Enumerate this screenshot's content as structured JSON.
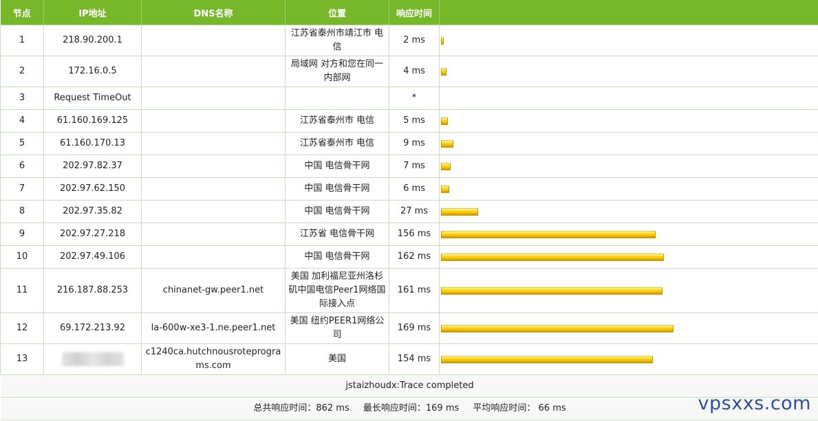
{
  "headers": {
    "node": "节点",
    "ip": "IP地址",
    "dns": "DNS名称",
    "location": "位置",
    "response": "响应时间"
  },
  "hops": [
    {
      "node": "1",
      "ip": "218.90.200.1",
      "dns": "",
      "location": "江苏省泰州市靖江市 电信",
      "time": "2 ms",
      "ms": 2
    },
    {
      "node": "2",
      "ip": "172.16.0.5",
      "dns": "",
      "location": "局域网 对方和您在同一内部网",
      "time": "4 ms",
      "ms": 4
    },
    {
      "node": "3",
      "ip": "Request TimeOut",
      "dns": "",
      "location": "",
      "time": "*",
      "ms": null
    },
    {
      "node": "4",
      "ip": "61.160.169.125",
      "dns": "",
      "location": "江苏省泰州市 电信",
      "time": "5 ms",
      "ms": 5
    },
    {
      "node": "5",
      "ip": "61.160.170.13",
      "dns": "",
      "location": "江苏省泰州市 电信",
      "time": "9 ms",
      "ms": 9
    },
    {
      "node": "6",
      "ip": "202.97.82.37",
      "dns": "",
      "location": "中国 电信骨干网",
      "time": "7 ms",
      "ms": 7
    },
    {
      "node": "7",
      "ip": "202.97.62.150",
      "dns": "",
      "location": "中国 电信骨干网",
      "time": "6 ms",
      "ms": 6
    },
    {
      "node": "8",
      "ip": "202.97.35.82",
      "dns": "",
      "location": "中国 电信骨干网",
      "time": "27 ms",
      "ms": 27
    },
    {
      "node": "9",
      "ip": "202.97.27.218",
      "dns": "",
      "location": "江苏省 电信骨干网",
      "time": "156 ms",
      "ms": 156
    },
    {
      "node": "10",
      "ip": "202.97.49.106",
      "dns": "",
      "location": "中国 电信骨干网",
      "time": "162 ms",
      "ms": 162
    },
    {
      "node": "11",
      "ip": "216.187.88.253",
      "dns": "chinanet-gw.peer1.net",
      "location": "美国 加利福尼亚州洛杉矶中国电信Peer1网络国际接入点",
      "time": "161 ms",
      "ms": 161
    },
    {
      "node": "12",
      "ip": "69.172.213.92",
      "dns": "la-600w-xe3-1.ne.peer1.net",
      "location": "美国 纽约PEER1网络公司",
      "time": "169 ms",
      "ms": 169
    },
    {
      "node": "13",
      "ip": "",
      "dns": "c1240ca.hutchnousroteprograms.com",
      "location": "美国",
      "time": "154 ms",
      "ms": 154,
      "ip_redacted": true
    }
  ],
  "status": "jstaizhoudx:Trace completed",
  "summary": {
    "total": "总共响应时间：862 ms",
    "max": "最长响应时间：169 ms",
    "avg": "平均响应时间： 66 ms"
  },
  "watermark": "vpsxxs.com",
  "colors": {
    "header_bg": "#77b82b",
    "bar_fill": "#f5c400",
    "watermark": "#2a4f9a"
  }
}
